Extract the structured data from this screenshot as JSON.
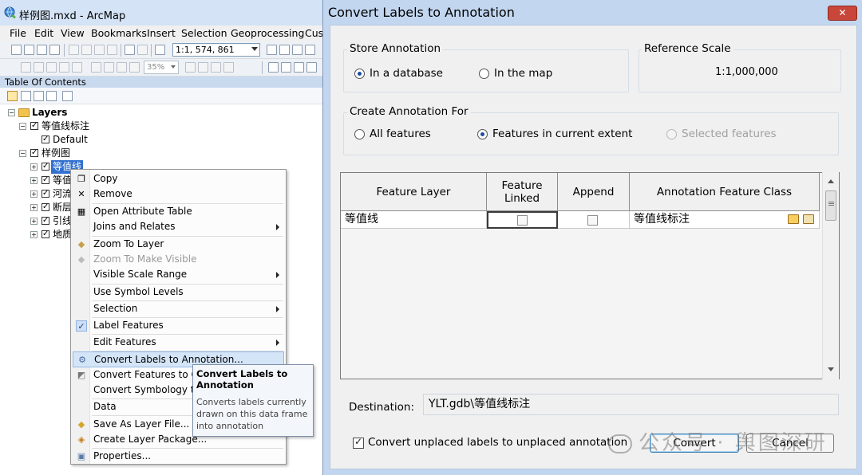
{
  "arcmap": {
    "title": "样例图.mxd - ArcMap",
    "menus": [
      "File",
      "Edit",
      "View",
      "Bookmarks",
      "Insert",
      "Selection",
      "Geoprocessing",
      "Cust"
    ],
    "scale": "1:1, 574, 861",
    "zoom": "35%",
    "toc_title": "Table Of Contents",
    "tree": {
      "root": "Layers",
      "group1": "等值线标注",
      "group1_child": "Default",
      "group2": "样例图",
      "layers": [
        "等值线",
        "等值",
        "河流",
        "断层",
        "引线",
        "地质"
      ]
    }
  },
  "context_menu": {
    "items": [
      {
        "label": "Copy"
      },
      {
        "label": "Remove"
      },
      {
        "label": "Open Attribute Table"
      },
      {
        "label": "Joins and Relates"
      },
      {
        "label": "Zoom To Layer"
      },
      {
        "label": "Zoom To Make Visible"
      },
      {
        "label": "Visible Scale Range"
      },
      {
        "label": "Use Symbol Levels"
      },
      {
        "label": "Selection"
      },
      {
        "label": "Label Features"
      },
      {
        "label": "Edit Features"
      },
      {
        "label": "Convert Labels to Annotation..."
      },
      {
        "label": "Convert Features to Gra"
      },
      {
        "label": "Convert Symbology to"
      },
      {
        "label": "Data"
      },
      {
        "label": "Save As Layer File..."
      },
      {
        "label": "Create Layer Package..."
      },
      {
        "label": "Properties..."
      }
    ]
  },
  "tooltip": {
    "title": "Convert Labels to Annotation",
    "body": "Converts labels currently drawn on this data frame into annotation"
  },
  "dialog": {
    "title": "Convert Labels to Annotation",
    "close": "✕",
    "store_annotation": {
      "title": "Store Annotation",
      "option_db": "In a database",
      "option_map": "In the map"
    },
    "reference_scale": {
      "title": "Reference Scale",
      "value": "1:1,000,000"
    },
    "create_for": {
      "title": "Create Annotation For",
      "all": "All features",
      "extent": "Features in current extent",
      "selected": "Selected features"
    },
    "table": {
      "headers": [
        "Feature Layer",
        "Feature\nLinked",
        "Append",
        "Annotation Feature Class"
      ],
      "row": {
        "layer": "等值线",
        "feature_linked": false,
        "append": false,
        "feature_class": "等值线标注"
      }
    },
    "destination_label": "Destination:",
    "destination_value": "YLT.gdb\\等值线标注",
    "convert_unplaced": "Convert unplaced labels to unplaced annotation",
    "convert_button": "Convert",
    "cancel_button": "Cancel"
  },
  "watermark": "公众号 · 舆图深研"
}
